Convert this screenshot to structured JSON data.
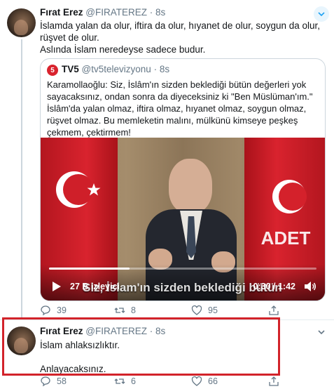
{
  "colors": {
    "link": "#1da1f2",
    "muted": "#657786",
    "border": "#ccd6dd",
    "highlight": "#d2232a",
    "tv5": "#d9232e"
  },
  "tweet1": {
    "name": "Fırat Erez",
    "handle": "@FIRATEREZ",
    "dot": "·",
    "time": "8s",
    "line1": "İslamda yalan da olur, iftira da olur, hıyanet de olur, soygun da olur,",
    "line2": "rüşvet de olur.",
    "line3": "Aslında İslam neredeyse sadece budur.",
    "avatar_icon": "avatar",
    "menu_icon": "chevron-down-icon",
    "quote": {
      "name": "TV5",
      "logo_text": "5",
      "handle": "@tv5televizyonu",
      "dot": "·",
      "time": "8s",
      "text": [
        "Karamollaoğlu: Siz, İslâm'ın sizden beklediği bütün değerleri yok",
        "sayacaksınız, ondan sonra da diyeceksiniz ki \"Ben Müslüman'ım.\"",
        "İslâm'da yalan olmaz, iftira olmaz, hıyanet olmaz, soygun olmaz,",
        "rüşvet olmaz. Bu memleketin malını, mülkünü kimseye peşkeş",
        "çekmem, çektirmem!"
      ],
      "video": {
        "subtitle": "Siz, İslam'ın sizden beklediği bütün",
        "views": "27 B izleyici",
        "time": "0:30 / 1:42",
        "progress": 0.3
      }
    },
    "actions": {
      "reply": "39",
      "retweet": "8",
      "like": "95"
    }
  },
  "tweet2": {
    "name": "Fırat Erez",
    "handle": "@FIRATEREZ",
    "dot": "·",
    "time": "8s",
    "line1": "İslam ahlaksızlıktır.",
    "line2": "Anlayacaksınız.",
    "menu_icon": "chevron-down-icon",
    "actions": {
      "reply": "58",
      "retweet": "6",
      "like": "66"
    }
  }
}
